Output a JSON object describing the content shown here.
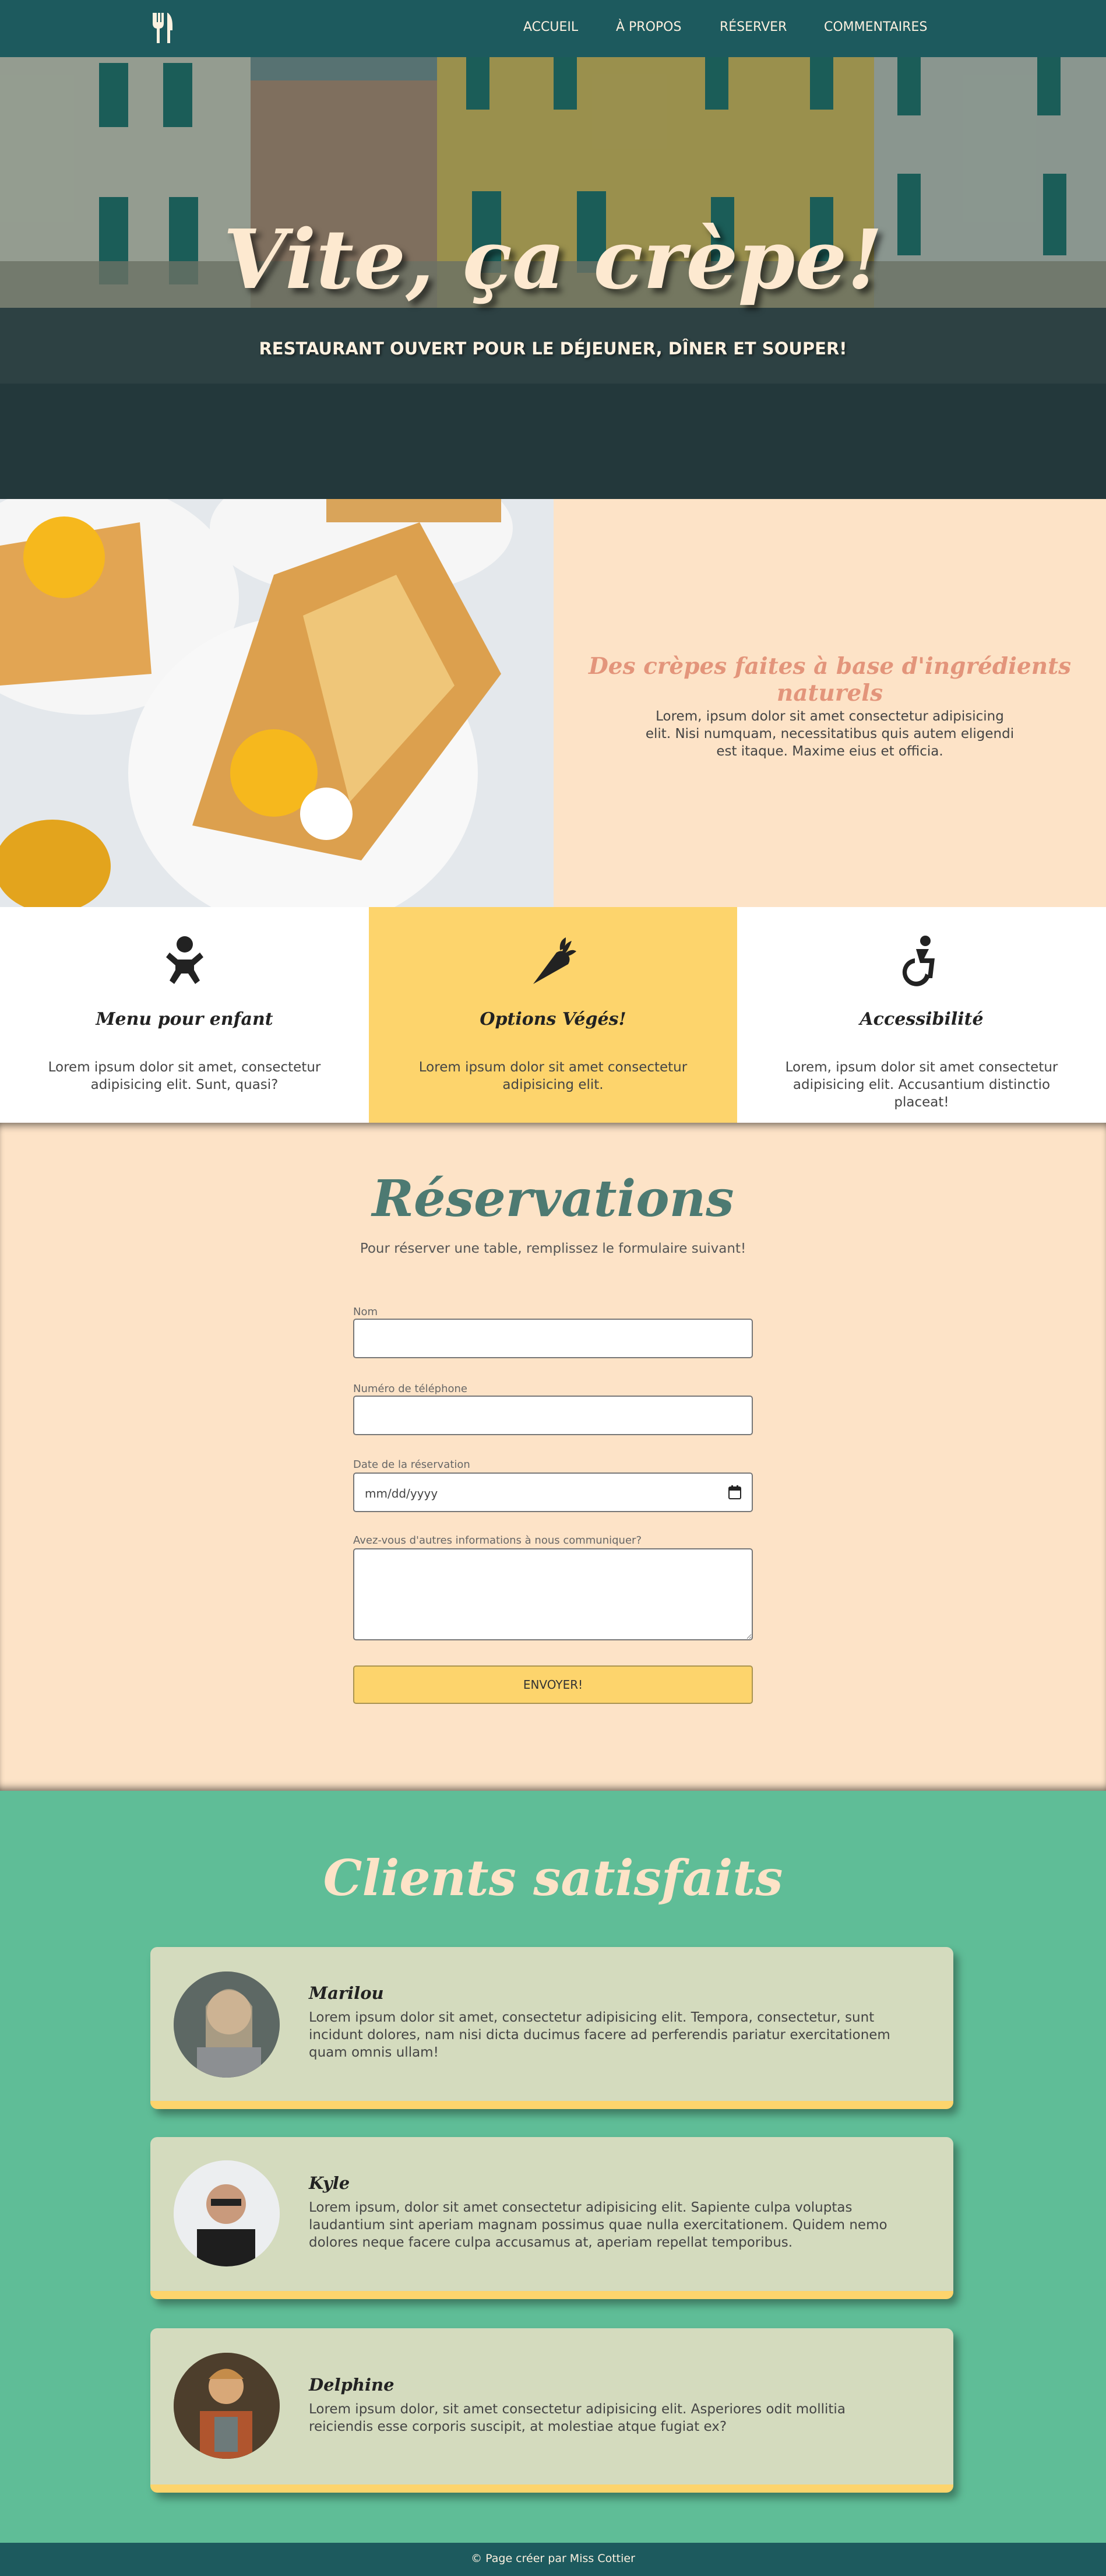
{
  "nav": {
    "logo_icon": "fork-knife-icon",
    "links": [
      "ACCUEIL",
      "À PROPOS",
      "RÉSERVER",
      "COMMENTAIRES"
    ]
  },
  "hero": {
    "title": "Vite, ça crèpe!",
    "subtitle": "RESTAURANT OUVERT POUR LE DÉJEUNER, DÎNER ET SOUPER!"
  },
  "feature": {
    "title": "Des crèpes faites à base d'ingrédients naturels",
    "text": "Lorem, ipsum dolor sit amet consectetur adipisicing elit. Nisi numquam, necessitatibus quis autem eligendi est itaque. Maxime eius et officia."
  },
  "services": [
    {
      "icon": "baby-icon",
      "title": "Menu pour enfant",
      "text": "Lorem ipsum dolor sit amet, consectetur adipisicing elit. Sunt, quasi?"
    },
    {
      "icon": "carrot-icon",
      "title": "Options Végés!",
      "text": "Lorem ipsum dolor sit amet consectetur adipisicing elit."
    },
    {
      "icon": "wheelchair-icon",
      "title": "Accessibilité",
      "text": "Lorem, ipsum dolor sit amet consectetur adipisicing elit. Accusantium distinctio placeat!"
    }
  ],
  "reservations": {
    "title": "Réservations",
    "intro": "Pour réserver une table, remplissez le formulaire suivant!",
    "name_label": "Nom",
    "phone_label": "Numéro de téléphone",
    "date_label": "Date de la réservation",
    "date_placeholder": "mm/dd/yyyy",
    "message_label": "Avez-vous d'autres informations à nous communiquer?",
    "submit_label": "ENVOYER!"
  },
  "testimonials": {
    "title": "Clients satisfaits",
    "items": [
      {
        "name": "Marilou",
        "text": "Lorem ipsum dolor sit amet, consectetur adipisicing elit. Tempora, consectetur, sunt incidunt dolores, nam nisi dicta ducimus facere ad perferendis pariatur exercitationem quam omnis ullam!"
      },
      {
        "name": "Kyle",
        "text": "Lorem ipsum, dolor sit amet consectetur adipisicing elit. Sapiente culpa voluptas laudantium sint aperiam magnam possimus quae nulla exercitationem. Quidem nemo dolores neque facere culpa accusamus at, aperiam repellat temporibus."
      },
      {
        "name": "Delphine",
        "text": "Lorem ipsum dolor, sit amet consectetur adipisicing elit. Asperiores odit mollitia reiciendis esse corporis suscipit, at molestiae atque fugiat ex?"
      }
    ]
  },
  "footer": {
    "text": "© Page créer par Miss Cottier"
  },
  "colors": {
    "nav": "#1d5a5e",
    "peach": "#fde3c7",
    "yellow": "#fdd46c",
    "green": "#5fbd97",
    "card": "#d4dbbe",
    "salmon": "#e3957b"
  }
}
